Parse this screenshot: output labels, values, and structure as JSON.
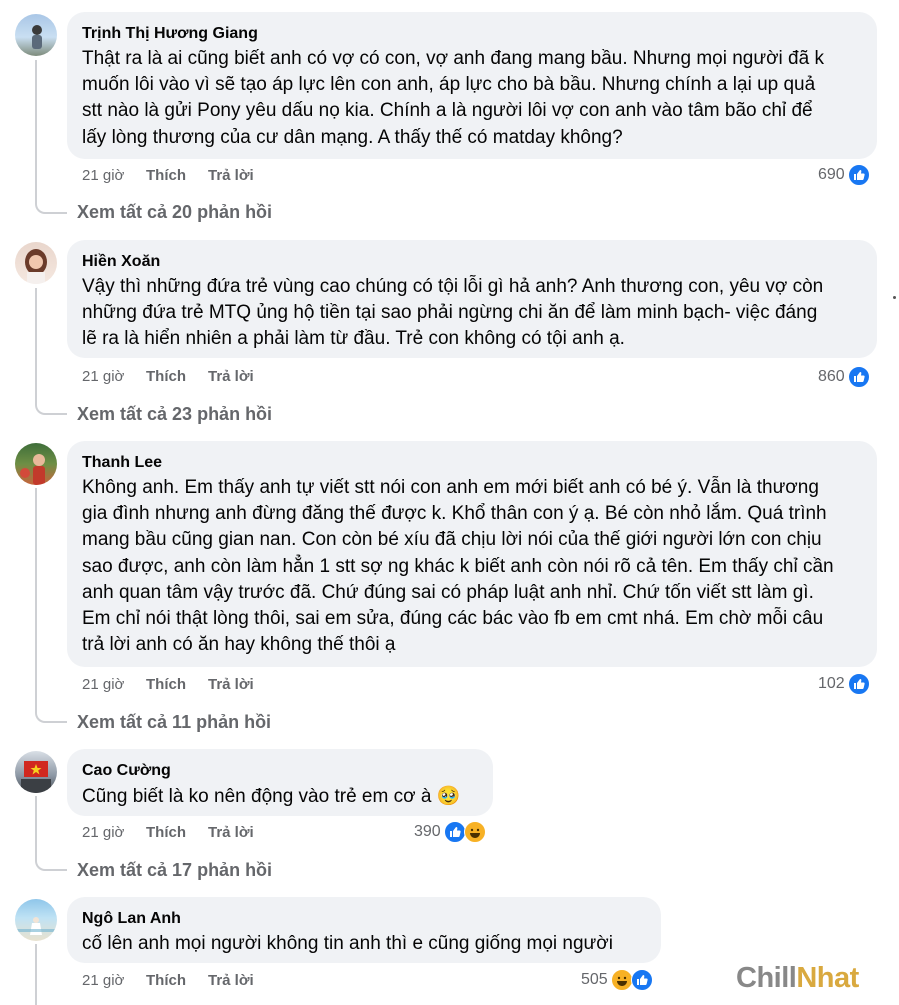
{
  "comments": [
    {
      "author": "Trịnh Thị Hương Giang",
      "text": "Thật ra là ai cũng biết anh có vợ có con, vợ anh đang mang bầu. Nhưng mọi người đã k\nmuốn lôi vào vì sẽ tạo áp lực lên con anh, áp lực cho bà bầu. Nhưng chính a lại up quả\nstt nào là gửi Pony yêu dấu nọ kia. Chính a là người lôi vợ con anh vào tâm bão chỉ để\nlấy lòng thương của cư dân mạng. A thấy thế có matday không?",
      "time": "21 giờ",
      "like": "Thích",
      "reply": "Trả lời",
      "reactions": "690",
      "view_replies": "Xem tất cả 20 phản hồi"
    },
    {
      "author": "Hiền Xoăn",
      "text": "Vậy thì những đứa trẻ vùng cao chúng có tội lỗi gì hả anh? Anh thương con, yêu vợ còn\nnhững đứa trẻ MTQ ủng hộ tiền tại sao phải ngừng chi ăn để làm minh bạch- việc đáng\nlẽ ra là hiển nhiên a phải làm từ đầu. Trẻ con không có tội anh ạ.",
      "time": "21 giờ",
      "like": "Thích",
      "reply": "Trả lời",
      "reactions": "860",
      "view_replies": "Xem tất cả 23 phản hồi"
    },
    {
      "author": "Thanh Lee",
      "text": "Không anh. Em thấy anh tự viết stt nói con anh em mới biết anh có bé ý. Vẫn là thương\ngia đình nhưng anh đừng đăng thế được k. Khổ thân con ý ạ. Bé còn nhỏ lắm. Quá trình\nmang bầu cũng gian nan. Con còn bé xíu đã chịu lời nói của thế giới người lớn con chịu\nsao được, anh còn làm hẳn 1 stt sợ ng khác k biết anh còn nói rõ cả tên. Em thấy chỉ cần\nanh quan tâm vậy trước đã. Chứ đúng sai có pháp luật anh nhỉ. Chứ tốn viết stt làm gì.\nEm chỉ nói thật lòng thôi, sai em sửa, đúng các bác vào fb em cmt nhá. Em chờ mỗi câu\ntrả lời anh có ăn hay không thế thôi ạ",
      "time": "21 giờ",
      "like": "Thích",
      "reply": "Trả lời",
      "reactions": "102",
      "view_replies": "Xem tất cả 11 phản hồi"
    },
    {
      "author": "Cao Cường",
      "text": "Cũng biết là ko nên động vào trẻ em cơ à",
      "emoji": "🥹",
      "time": "21 giờ",
      "like": "Thích",
      "reply": "Trả lời",
      "reactions": "390",
      "view_replies": "Xem tất cả 17 phản hồi"
    },
    {
      "author": "Ngô Lan Anh",
      "text": "cố lên anh mọi người không tin anh thì e cũng giống mọi người",
      "time": "21 giờ",
      "like": "Thích",
      "reply": "Trả lời",
      "reactions": "505"
    }
  ],
  "icons": {
    "like": "like-reaction-icon",
    "haha": "haha-reaction-icon",
    "like_color": "#1877f2",
    "haha_color": "#f7b125"
  },
  "watermark": {
    "part1": "Chill",
    "part2": "Nhat"
  }
}
